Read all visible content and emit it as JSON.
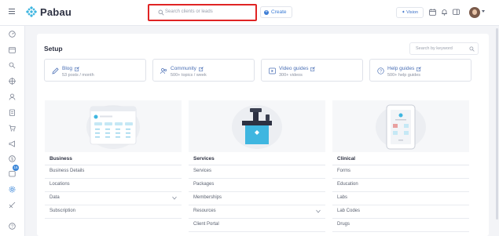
{
  "brand": {
    "name": "Pabau"
  },
  "search": {
    "placeholder": "Search clients or leads"
  },
  "topbar": {
    "create_label": "Create",
    "vision_label": "Vision"
  },
  "rail": {
    "badge_count": "16"
  },
  "main": {
    "title": "Setup",
    "keyword_placeholder": "Search by keyword",
    "resources": [
      {
        "title": "Blog",
        "subtitle": "53 posts / month",
        "icon": "pencil-icon"
      },
      {
        "title": "Community",
        "subtitle": "500+ topics / week",
        "icon": "people-icon"
      },
      {
        "title": "Video guides",
        "subtitle": "300+ videos",
        "icon": "play-icon"
      },
      {
        "title": "Help guides",
        "subtitle": "500+ help guides",
        "icon": "question-icon"
      }
    ],
    "categories": [
      {
        "title": "Business",
        "items": [
          {
            "label": "Business Details"
          },
          {
            "label": "Locations"
          },
          {
            "label": "Data",
            "expandable": true
          },
          {
            "label": "Subscription"
          }
        ]
      },
      {
        "title": "Services",
        "items": [
          {
            "label": "Services"
          },
          {
            "label": "Packages"
          },
          {
            "label": "Memberships"
          },
          {
            "label": "Resources",
            "expandable": true
          },
          {
            "label": "Client Portal"
          }
        ]
      },
      {
        "title": "Clinical",
        "items": [
          {
            "label": "Forms"
          },
          {
            "label": "Education"
          },
          {
            "label": "Labs"
          },
          {
            "label": "Lab Codes"
          },
          {
            "label": "Drugs"
          }
        ]
      }
    ]
  },
  "colors": {
    "accent": "#3a7bd5",
    "teal": "#3fb6e0",
    "highlight": "#e02424"
  }
}
